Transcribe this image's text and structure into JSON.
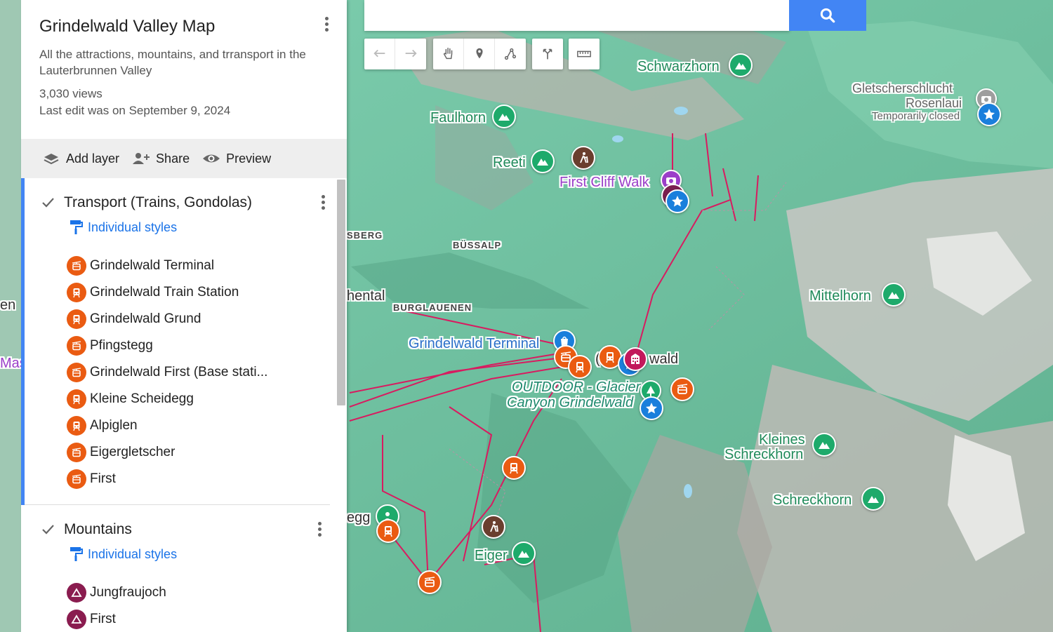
{
  "map": {
    "title": "Grindelwald Valley Map",
    "description": "All the attractions, mountains, and trransport in the Lauterbrunnen Valley",
    "views": "3,030 views",
    "last_edit": "Last edit was on September 9, 2024"
  },
  "actions": {
    "add_layer": "Add layer",
    "share": "Share",
    "preview": "Preview"
  },
  "search": {
    "placeholder": ""
  },
  "layers": [
    {
      "title": "Transport (Trains, Gondolas)",
      "styles_label": "Individual styles",
      "items": [
        {
          "label": "Grindelwald Terminal",
          "icon": "gondola-icon"
        },
        {
          "label": "Grindelwald Train Station",
          "icon": "train-icon"
        },
        {
          "label": "Grindelwald Grund",
          "icon": "train-icon"
        },
        {
          "label": "Pfingstegg",
          "icon": "gondola-icon"
        },
        {
          "label": "Grindelwald First (Base stati...",
          "icon": "gondola-icon"
        },
        {
          "label": "Kleine Scheidegg",
          "icon": "train-icon"
        },
        {
          "label": "Alpiglen",
          "icon": "train-icon"
        },
        {
          "label": "Eigergletscher",
          "icon": "gondola-icon"
        },
        {
          "label": "First",
          "icon": "gondola-icon"
        }
      ]
    },
    {
      "title": "Mountains",
      "styles_label": "Individual styles",
      "items": [
        {
          "label": "Jungfraujoch",
          "icon": "mountain-icon"
        },
        {
          "label": "First",
          "icon": "mountain-icon"
        }
      ]
    }
  ],
  "map_labels": {
    "schwarzhorn": "Schwarzhorn",
    "faulhorn": "Faulhorn",
    "reeti": "Reeti",
    "first_cliff_walk": "First Cliff Walk",
    "gletscherschlucht": "Gletscherschlucht",
    "rosenlaui": "Rosenlaui",
    "temporarily_closed": "Temporarily closed",
    "sberg": "SBERG",
    "bussalp": "BÜSSALP",
    "hental": "hental",
    "burglauenen": "BURGLAUENEN",
    "grindelwald_terminal": "Grindelwald Terminal",
    "wald": "wald",
    "outdoor_glacier": "OUTDOOR - Glacier",
    "canyon_grindelwald": "Canyon Grindelwald",
    "mittelhorn": "Mittelhorn",
    "kleines": "Kleines",
    "schreckhorn_small": "Schreckhorn",
    "schreckhorn": "Schreckhorn",
    "egg": "egg",
    "eiger": "Eiger",
    "en": "en",
    "mas": "Mas"
  },
  "colors": {
    "accent_blue": "#4285f4",
    "transport_orange": "#ea5b12",
    "mountain_green": "#1eaa6b",
    "mountain_layer_maroon": "#8a1c4f"
  }
}
